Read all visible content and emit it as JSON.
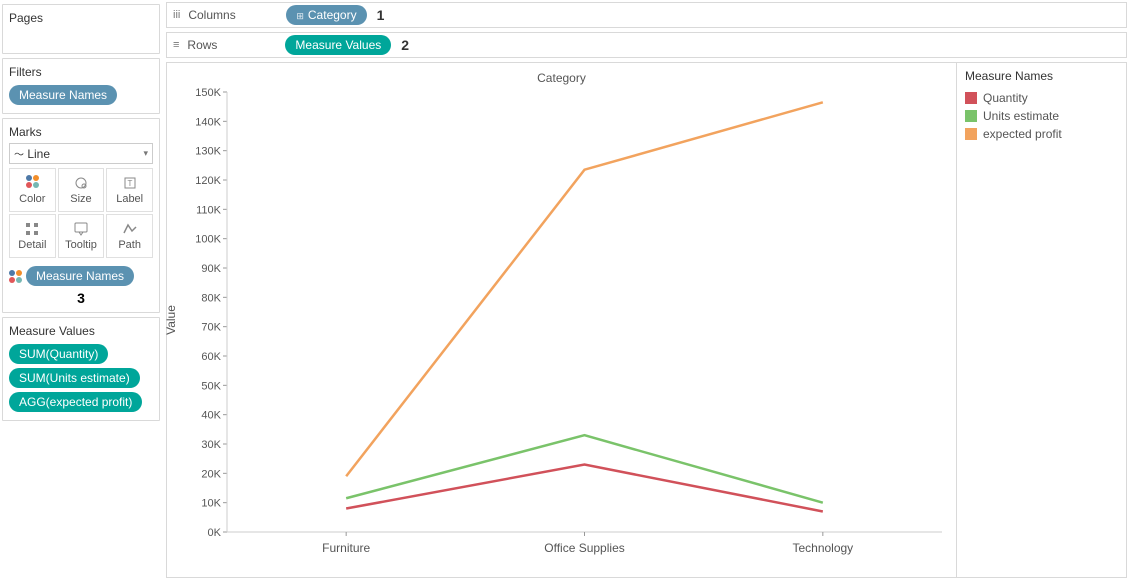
{
  "sidebar": {
    "pages_title": "Pages",
    "filters_title": "Filters",
    "filters_pill": "Measure Names",
    "marks_title": "Marks",
    "mark_type": "Line",
    "mark_cells": {
      "color": "Color",
      "size": "Size",
      "label": "Label",
      "detail": "Detail",
      "tooltip": "Tooltip",
      "path": "Path"
    },
    "marks_color_pill": "Measure Names",
    "marks_annotation": "3",
    "measure_values_title": "Measure Values",
    "measure_values_pills": [
      "SUM(Quantity)",
      "SUM(Units estimate)",
      "AGG(expected profit)"
    ]
  },
  "shelves": {
    "columns_label": "Columns",
    "columns_pill": "Category",
    "columns_annotation": "1",
    "rows_label": "Rows",
    "rows_pill": "Measure Values",
    "rows_annotation": "2"
  },
  "legend": {
    "title": "Measure Names",
    "items": [
      {
        "label": "Quantity",
        "color": "#d1515a"
      },
      {
        "label": "Units estimate",
        "color": "#7ac36a"
      },
      {
        "label": "expected profit",
        "color": "#f2a35e"
      }
    ]
  },
  "chart_data": {
    "type": "line",
    "title": "Category",
    "ylabel": "Value",
    "xlabel": "",
    "categories": [
      "Furniture",
      "Office Supplies",
      "Technology"
    ],
    "ylim": [
      0,
      150000
    ],
    "y_ticks": [
      0,
      10000,
      20000,
      30000,
      40000,
      50000,
      60000,
      70000,
      80000,
      90000,
      100000,
      110000,
      120000,
      130000,
      140000,
      150000
    ],
    "y_tick_labels": [
      "0K",
      "10K",
      "20K",
      "30K",
      "40K",
      "50K",
      "60K",
      "70K",
      "80K",
      "90K",
      "100K",
      "110K",
      "120K",
      "130K",
      "140K",
      "150K"
    ],
    "series": [
      {
        "name": "Quantity",
        "color": "#d1515a",
        "values": [
          8000,
          23000,
          7000
        ]
      },
      {
        "name": "Units estimate",
        "color": "#7ac36a",
        "values": [
          11500,
          33000,
          10000
        ]
      },
      {
        "name": "expected profit",
        "color": "#f2a35e",
        "values": [
          19000,
          123500,
          146500
        ]
      }
    ]
  }
}
